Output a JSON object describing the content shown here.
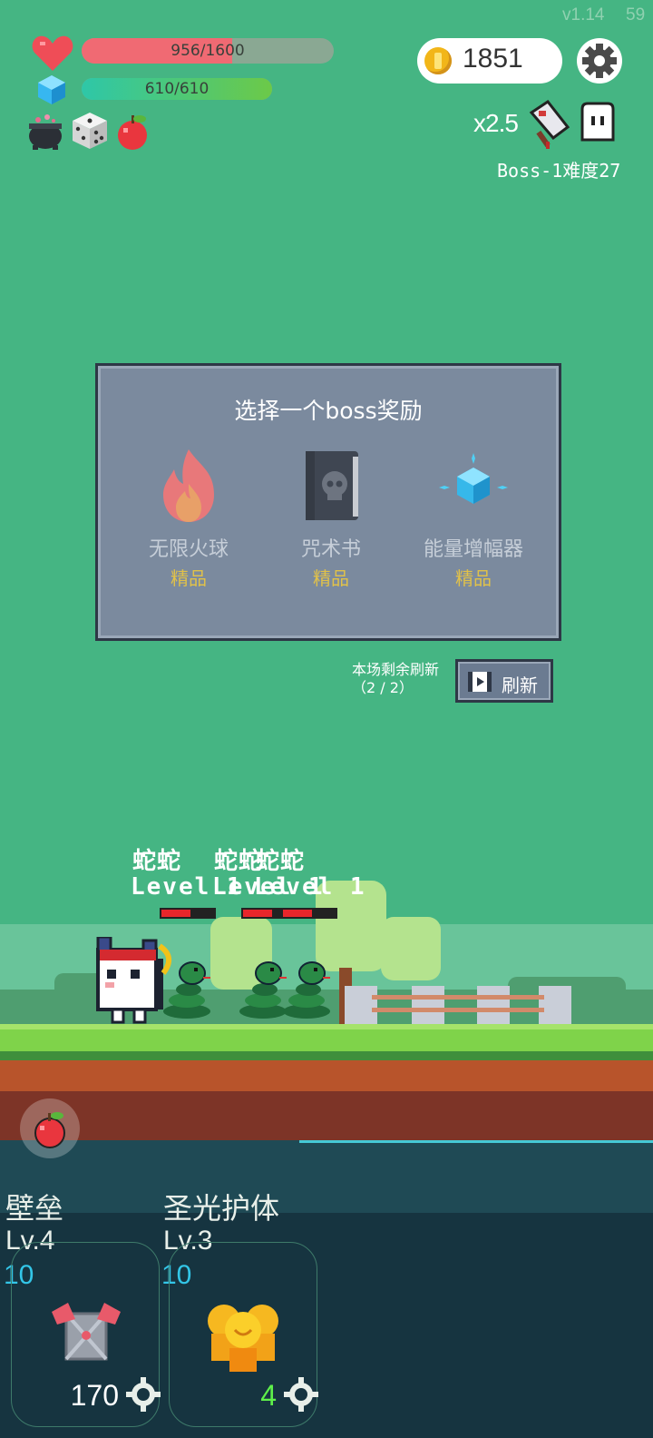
{
  "hud": {
    "version": "v1.14",
    "fps": "59",
    "hp": {
      "text": "956/1600",
      "fraction": 0.5975
    },
    "mp": {
      "text": "610/610",
      "fraction": 1.0
    },
    "coins": "1851",
    "speed_multiplier": "x2.5",
    "boss_label": "Boss-1难度27",
    "inventory_icons": [
      "cauldron-icon",
      "dice-icon",
      "apple-icon"
    ]
  },
  "reward_panel": {
    "title": "选择一个boss奖励",
    "items": [
      {
        "name": "无限火球",
        "rarity": "精品",
        "icon": "fireball-icon"
      },
      {
        "name": "咒术书",
        "rarity": "精品",
        "icon": "spellbook-icon"
      },
      {
        "name": "能量增幅器",
        "rarity": "精品",
        "icon": "energy-crystal-icon"
      }
    ],
    "refresh_note_line1": "本场剩余刷新",
    "refresh_note_line2": "（2 / 2）",
    "refresh_label": "刷新"
  },
  "enemies": [
    {
      "name": "蛇蛇",
      "level": "Level 1",
      "hp_fraction": 0.55
    },
    {
      "name": "蛇蛇",
      "level": "Level 1",
      "hp_fraction": 0.55
    },
    {
      "name": "蛇蛇",
      "level": "Level 1",
      "hp_fraction": 0.55
    }
  ],
  "skills": [
    {
      "name": "壁垒",
      "level": "Lv.4",
      "cost": "10",
      "count": "170",
      "count_color": "#ffffff",
      "icon": "armor-icon"
    },
    {
      "name": "圣光护体",
      "level": "Lv.3",
      "cost": "10",
      "count": "4",
      "count_color": "#5ef04a",
      "icon": "holy-light-icon"
    }
  ]
}
